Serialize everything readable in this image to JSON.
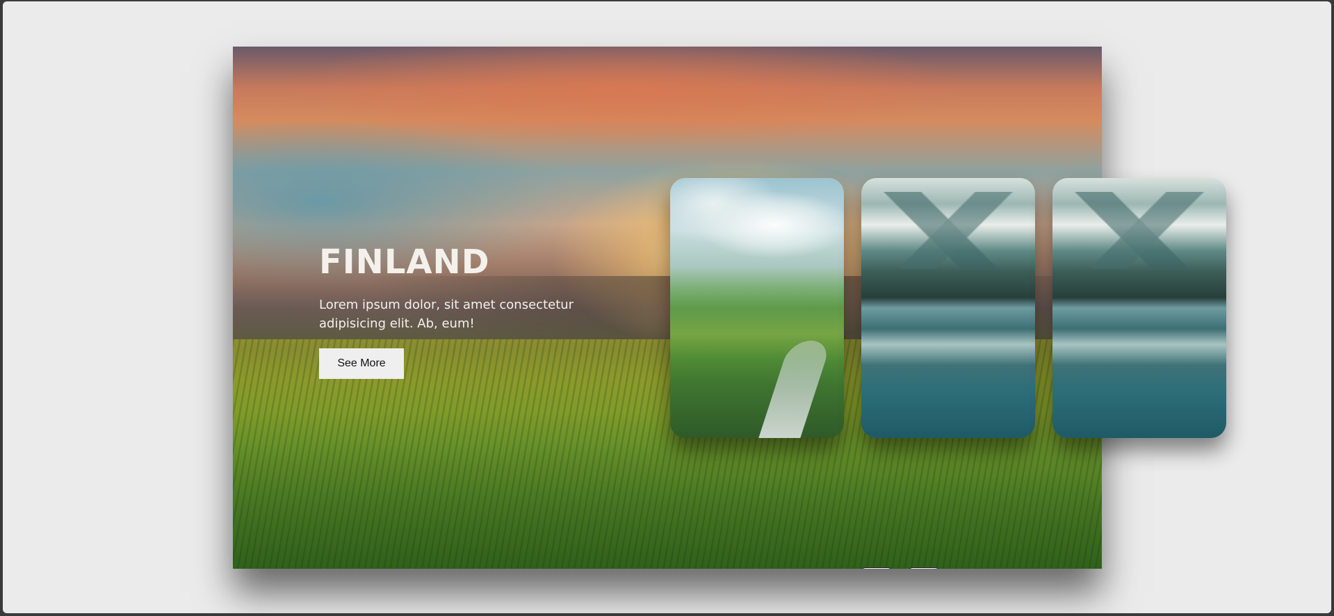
{
  "hero": {
    "title": "FINLAND",
    "description": "Lorem ipsum dolor, sit amet consectetur adipisicing elit. Ab, eum!",
    "button_label": "See More"
  },
  "thumbnails": [
    {
      "scene": "green river valley"
    },
    {
      "scene": "mountain lake reflection"
    },
    {
      "scene": "mountain lake reflection"
    }
  ],
  "controls": {
    "prev_icon": "play-square-icon",
    "next_icon": "play-square-icon"
  },
  "colors": {
    "page_background": "#ebebeb",
    "button_background": "#efefef",
    "hero_text": "#f4f1ec"
  }
}
